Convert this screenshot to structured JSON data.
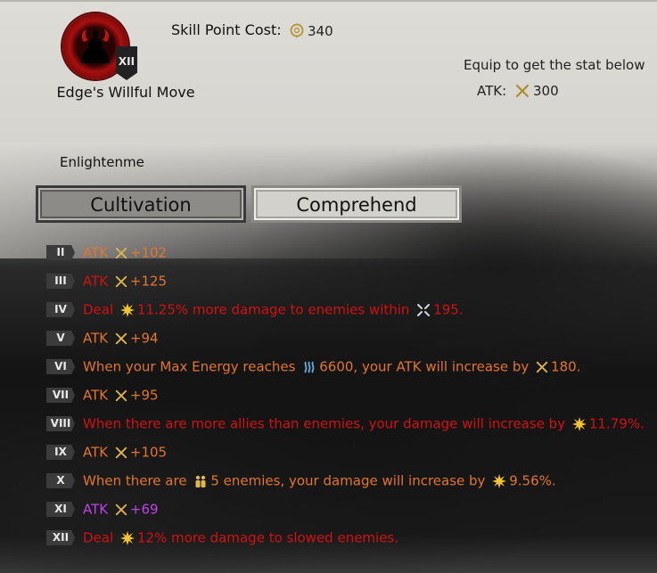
{
  "skill": {
    "name": "Edge's Willful Move",
    "rank": "XII",
    "cost_label": "Skill Point Cost:",
    "cost_value": "340",
    "cost_icon": "skill-point-icon"
  },
  "equip": {
    "label": "Equip to get the stat below",
    "stat_label": "ATK:",
    "stat_icon": "crossed-swords-icon",
    "stat_value": "300"
  },
  "section_label": "Enlightenme",
  "tabs": [
    {
      "label": "Cultivation",
      "active": true
    },
    {
      "label": "Comprehend",
      "active": false
    }
  ],
  "colors": {
    "orange": "#e3752d",
    "red": "#d21111",
    "purple": "#c043e8",
    "emblem_red": "#a80f0f"
  },
  "levels": [
    {
      "numeral": "II",
      "color": "orange",
      "parts": [
        "ATK",
        "+102"
      ],
      "icons": [
        "crossed-swords-icon"
      ]
    },
    {
      "numeral": "III",
      "color": "red",
      "parts": [
        "ATK",
        "+125"
      ],
      "icons": [
        "crossed-swords-icon"
      ]
    },
    {
      "numeral": "IV",
      "color": "red",
      "parts": [
        "Deal",
        "11.25% more damage to enemies within",
        "195."
      ],
      "icons": [
        "burst-icon",
        "range-arrows-icon"
      ]
    },
    {
      "numeral": "V",
      "color": "orange",
      "parts": [
        "ATK",
        "+94"
      ],
      "icons": [
        "crossed-swords-icon"
      ]
    },
    {
      "numeral": "VI",
      "color": "orange",
      "parts": [
        "When your Max Energy reaches",
        "6600, your ATK will increase by",
        "180."
      ],
      "icons": [
        "energy-waves-icon",
        "crossed-swords-icon"
      ]
    },
    {
      "numeral": "VII",
      "color": "orange",
      "parts": [
        "ATK",
        "+95"
      ],
      "icons": [
        "crossed-swords-icon"
      ]
    },
    {
      "numeral": "VIII",
      "color": "red",
      "parts": [
        "When there are more allies than enemies, your damage will increase by",
        "11.79%."
      ],
      "icons": [
        "burst-icon"
      ]
    },
    {
      "numeral": "IX",
      "color": "orange",
      "parts": [
        "ATK",
        "+105"
      ],
      "icons": [
        "crossed-swords-icon"
      ]
    },
    {
      "numeral": "X",
      "color": "orange",
      "parts": [
        "When there are",
        "5 enemies, your damage will increase by",
        "9.56%."
      ],
      "icons": [
        "enemy-group-icon",
        "burst-icon"
      ]
    },
    {
      "numeral": "XI",
      "color": "purple",
      "parts": [
        "ATK",
        "+69"
      ],
      "icons": [
        "crossed-swords-icon"
      ]
    },
    {
      "numeral": "XII",
      "color": "red",
      "parts": [
        "Deal",
        "12% more damage to slowed enemies."
      ],
      "icons": [
        "burst-icon"
      ]
    }
  ]
}
